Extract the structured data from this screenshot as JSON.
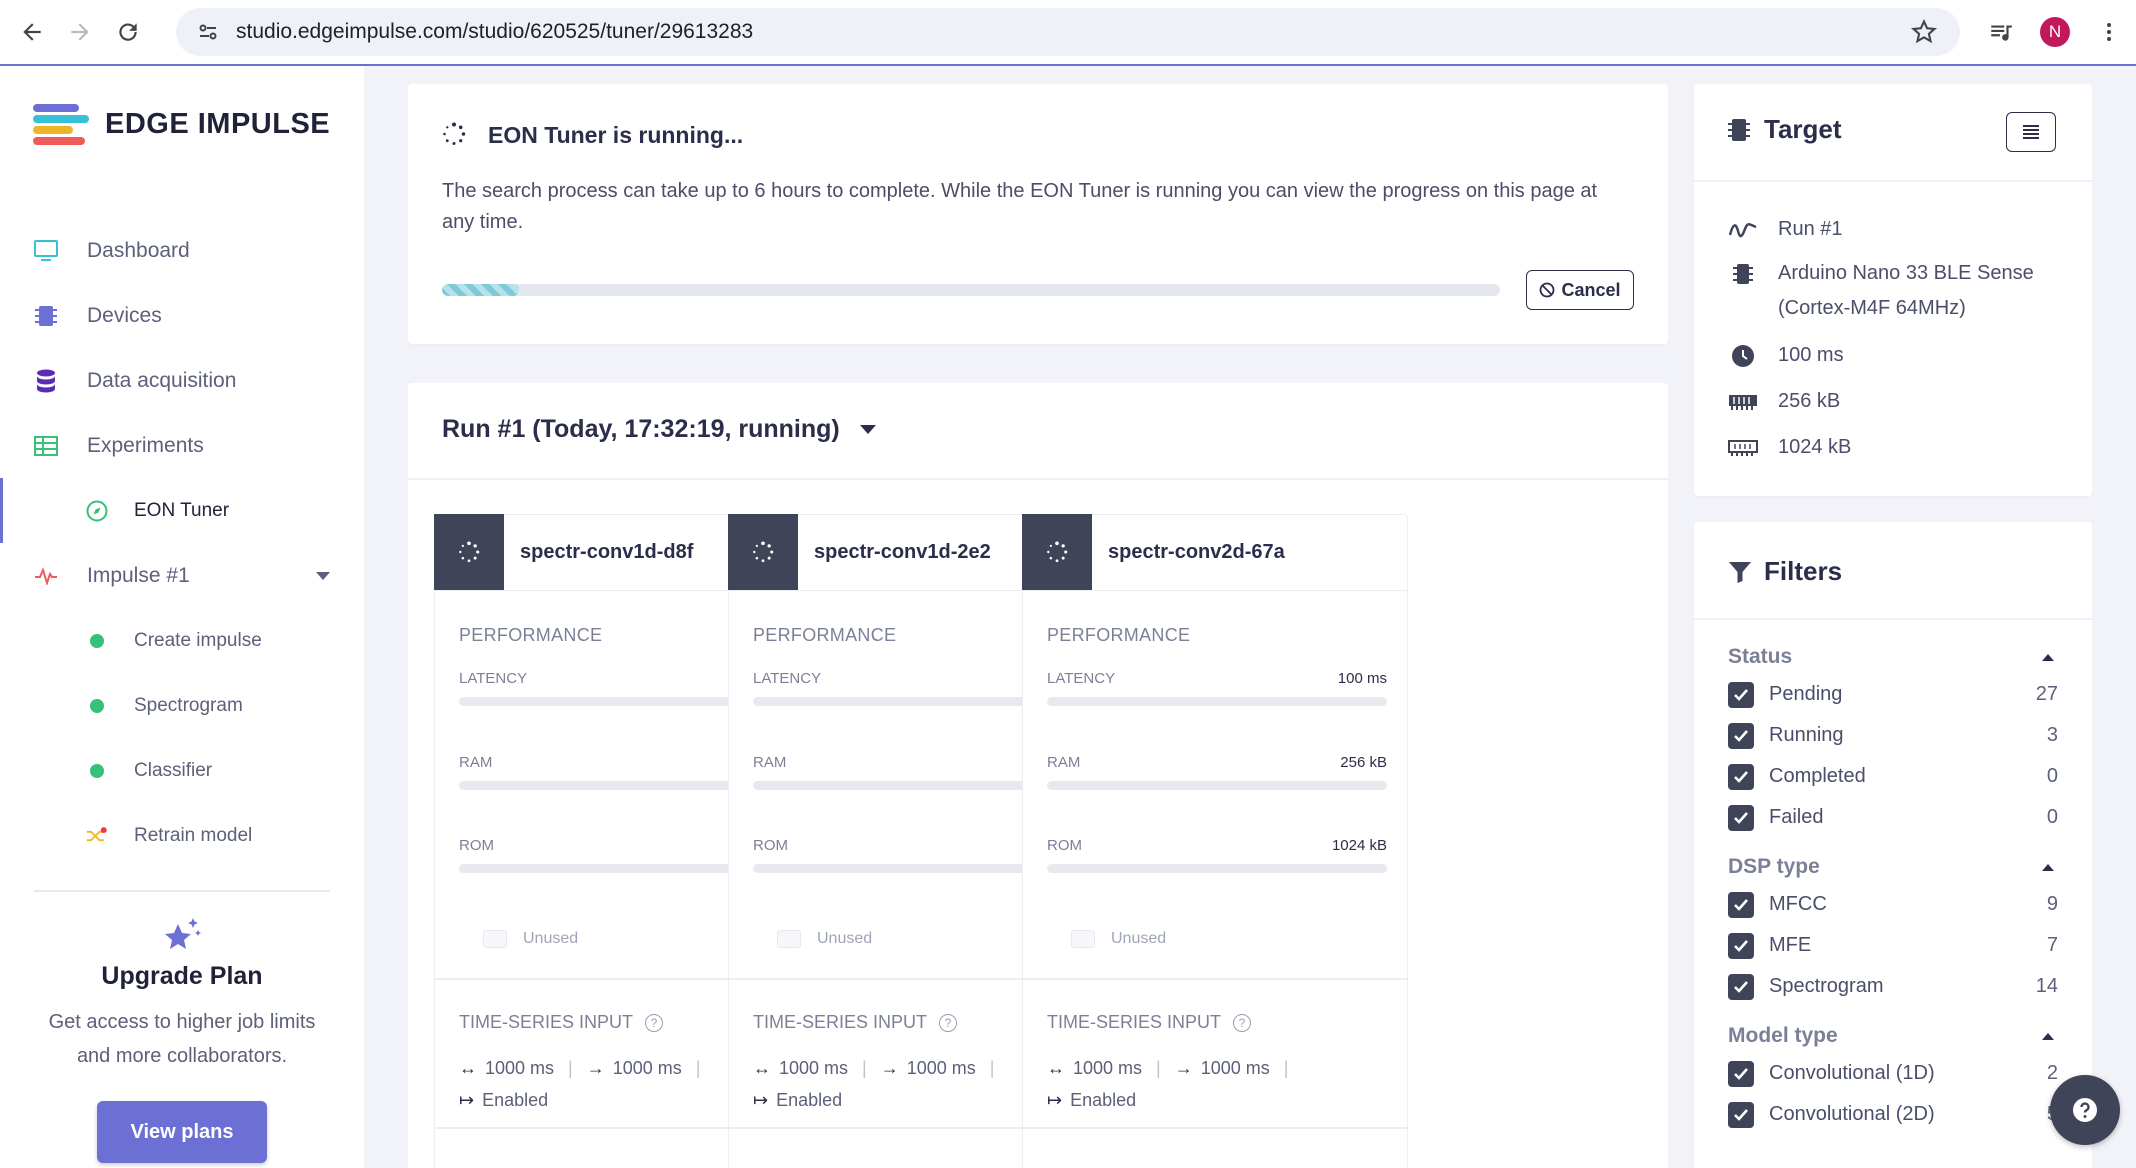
{
  "browser": {
    "url": "studio.edgeimpulse.com/studio/620525/tuner/29613283",
    "avatar_initial": "N"
  },
  "sidebar": {
    "brand": "EDGE IMPULSE",
    "items": [
      {
        "label": "Dashboard",
        "icon": "monitor-icon"
      },
      {
        "label": "Devices",
        "icon": "chip-icon"
      },
      {
        "label": "Data acquisition",
        "icon": "database-icon"
      },
      {
        "label": "Experiments",
        "icon": "table-icon"
      },
      {
        "label": "EON Tuner",
        "icon": "compass-icon",
        "active": true
      },
      {
        "label": "Impulse #1",
        "icon": "pulse-icon"
      },
      {
        "label": "Create impulse",
        "icon": "status-dot-icon"
      },
      {
        "label": "Spectrogram",
        "icon": "status-dot-icon"
      },
      {
        "label": "Classifier",
        "icon": "status-dot-icon"
      },
      {
        "label": "Retrain model",
        "icon": "shuffle-icon"
      }
    ],
    "upgrade": {
      "title": "Upgrade Plan",
      "description": "Get access to higher job limits and more collaborators.",
      "button": "View plans"
    }
  },
  "status": {
    "title": "EON Tuner is running...",
    "description": "The search process can take up to 6 hours to complete. While the EON Tuner is running you can view the progress on this page at any time.",
    "progress": 0.073,
    "cancel": "Cancel"
  },
  "run": {
    "title": "Run #1 (Today, 17:32:19, running)",
    "models": [
      {
        "name": "spectr-conv1d-d8f"
      },
      {
        "name": "spectr-conv1d-2e2"
      },
      {
        "name": "spectr-conv2d-67a"
      }
    ],
    "labels": {
      "performance": "PERFORMANCE",
      "latency": "LATENCY",
      "ram": "RAM",
      "rom": "ROM",
      "unused": "Unused",
      "ts_input": "TIME-SERIES INPUT",
      "window": "1000 ms",
      "stride": "1000 ms",
      "enabled": "Enabled",
      "pipe": "|"
    },
    "values": {
      "latency": "100 ms",
      "ram": "256 kB",
      "rom": "1024 kB"
    }
  },
  "target": {
    "title": "Target",
    "run": "Run #1",
    "device_line1": "Arduino Nano 33 BLE Sense",
    "device_line2": "(Cortex-M4F 64MHz)",
    "latency": "100 ms",
    "ram": "256 kB",
    "rom": "1024 kB"
  },
  "filters": {
    "title": "Filters",
    "groups": [
      {
        "title": "Status",
        "options": [
          {
            "label": "Pending",
            "count": "27"
          },
          {
            "label": "Running",
            "count": "3"
          },
          {
            "label": "Completed",
            "count": "0"
          },
          {
            "label": "Failed",
            "count": "0"
          }
        ]
      },
      {
        "title": "DSP type",
        "options": [
          {
            "label": "MFCC",
            "count": "9"
          },
          {
            "label": "MFE",
            "count": "7"
          },
          {
            "label": "Spectrogram",
            "count": "14"
          }
        ]
      },
      {
        "title": "Model type",
        "options": [
          {
            "label": "Convolutional (1D)",
            "count": "2"
          },
          {
            "label": "Convolutional (2D)",
            "count": "5"
          }
        ]
      }
    ]
  },
  "colors": {
    "accent": "#6c6fd4",
    "dark": "#3f4459",
    "success": "#37c078"
  }
}
